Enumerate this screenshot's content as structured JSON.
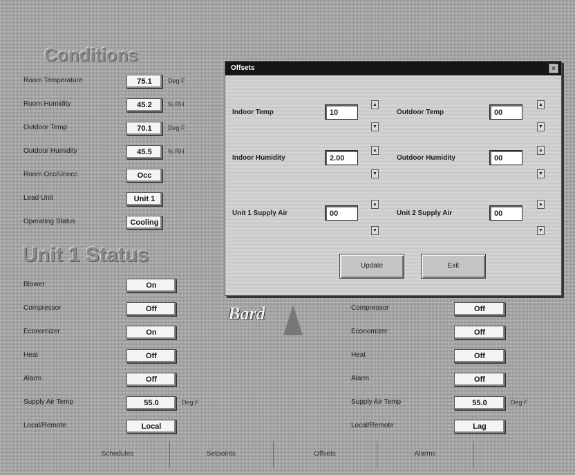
{
  "window": {
    "title_bar_text": ""
  },
  "menu": [
    "",
    ""
  ],
  "conditions": {
    "title": "Conditions",
    "rows": [
      {
        "label": "Room Temperature",
        "value": "75.1",
        "unit": "Deg F"
      },
      {
        "label": "Room Humidity",
        "value": "45.2",
        "unit": "% RH"
      },
      {
        "label": "Outdoor Temp",
        "value": "70.1",
        "unit": "Deg F"
      },
      {
        "label": "Outdoor Humidity",
        "value": "45.5",
        "unit": "% RH"
      },
      {
        "label": "Room Occ/Unocc",
        "value": "Occ",
        "unit": ""
      },
      {
        "label": "Lead Unit",
        "value": "Unit 1",
        "unit": ""
      },
      {
        "label": "Operating Status",
        "value": "Cooling",
        "unit": ""
      }
    ]
  },
  "unit1": {
    "title": "Unit 1 Status",
    "rows": [
      {
        "label": "Blower",
        "value": "On",
        "unit": ""
      },
      {
        "label": "Compressor",
        "value": "Off",
        "unit": ""
      },
      {
        "label": "Economizer",
        "value": "On",
        "unit": ""
      },
      {
        "label": "Heat",
        "value": "Off",
        "unit": ""
      },
      {
        "label": "Alarm",
        "value": "Off",
        "unit": ""
      },
      {
        "label": "Supply Air Temp",
        "value": "55.0",
        "unit": "Deg F"
      },
      {
        "label": "Local/Remote",
        "value": "Local",
        "unit": ""
      }
    ]
  },
  "unit2": {
    "rows": [
      {
        "label": "Compressor",
        "value": "Off",
        "unit": ""
      },
      {
        "label": "Economizer",
        "value": "Off",
        "unit": ""
      },
      {
        "label": "Heat",
        "value": "Off",
        "unit": ""
      },
      {
        "label": "Alarm",
        "value": "Off",
        "unit": ""
      },
      {
        "label": "Supply Air Temp",
        "value": "55.0",
        "unit": "Deg F"
      },
      {
        "label": "Local/Remote",
        "value": "Lag",
        "unit": ""
      }
    ]
  },
  "logo": {
    "text": "Bard",
    "tagline": ""
  },
  "dialog": {
    "title": "Offsets",
    "close_glyph": "✕",
    "fields": [
      {
        "label": "Indoor Temp",
        "value": "10"
      },
      {
        "label": "Outdoor Temp",
        "value": "00"
      },
      {
        "label": "Indoor Humidity",
        "value": "2.00"
      },
      {
        "label": "Outdoor Humidity",
        "value": "00"
      },
      {
        "label": "Unit 1 Supply Air",
        "value": "00"
      },
      {
        "label": "Unit 2 Supply Air",
        "value": "00"
      }
    ],
    "spin_up": "▲",
    "spin_down": "▼",
    "ok_label": "Update",
    "cancel_label": "Exit"
  },
  "bottom_buttons": [
    "Schedules",
    "Setpoints",
    "Offsets",
    "Alarms"
  ]
}
